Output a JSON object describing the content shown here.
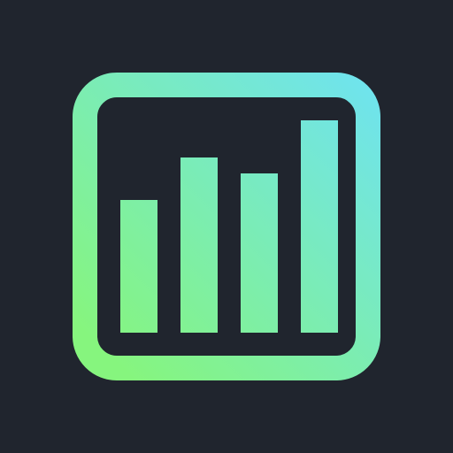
{
  "icon": {
    "name": "bar-chart-app-icon",
    "background_color": "#20252e",
    "gradient_start_color": "#86f57e",
    "gradient_end_color": "#6fe3ef",
    "bar_levels": [
      0.57,
      0.75,
      0.68,
      0.91
    ]
  }
}
